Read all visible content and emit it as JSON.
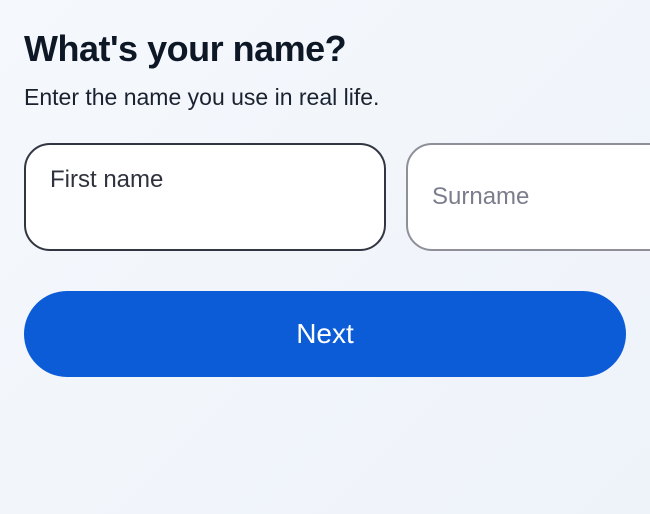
{
  "form": {
    "heading": "What's your name?",
    "subheading": "Enter the name you use in real life.",
    "first_name": {
      "placeholder": "First name",
      "value": ""
    },
    "surname": {
      "placeholder": "Surname",
      "value": ""
    },
    "next_label": "Next"
  },
  "colors": {
    "primary_button": "#0b5cd6",
    "text_dark": "#0e1726"
  }
}
